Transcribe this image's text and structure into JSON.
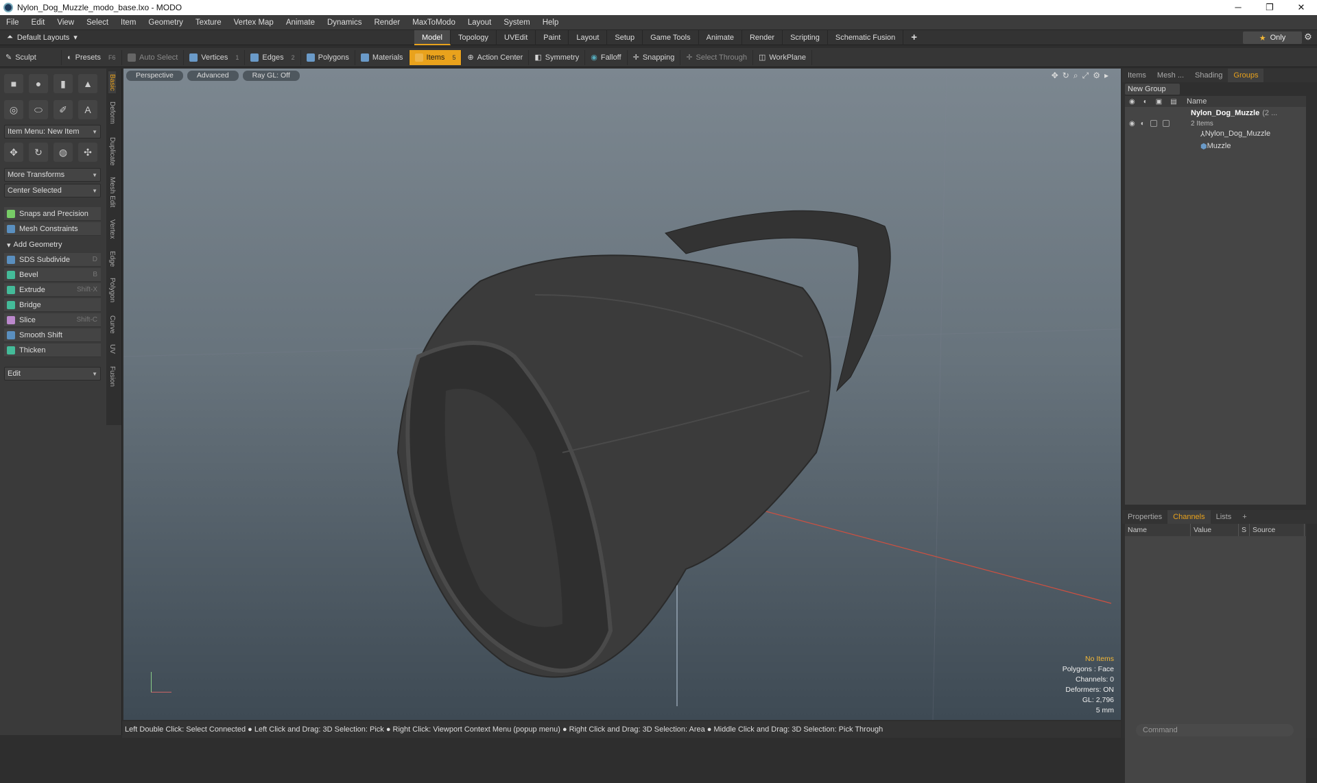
{
  "window": {
    "title": "Nylon_Dog_Muzzle_modo_base.lxo - MODO",
    "min": "─",
    "max": "❐",
    "close": "✕"
  },
  "menu": [
    "File",
    "Edit",
    "View",
    "Select",
    "Item",
    "Geometry",
    "Texture",
    "Vertex Map",
    "Animate",
    "Dynamics",
    "Render",
    "MaxToModo",
    "Layout",
    "System",
    "Help"
  ],
  "layouts": {
    "label": "Default Layouts",
    "tabs": [
      "Model",
      "Topology",
      "UVEdit",
      "Paint",
      "Layout",
      "Setup",
      "Game Tools",
      "Animate",
      "Render",
      "Scripting",
      "Schematic Fusion"
    ],
    "active": "Model",
    "plus": "+",
    "only": "Only"
  },
  "toolbar": {
    "sculpt": "Sculpt",
    "presets": "Presets",
    "presets_key": "F6",
    "auto_select": "Auto Select",
    "vertices": "Vertices",
    "vertices_n": "1",
    "edges": "Edges",
    "edges_n": "2",
    "polygons": "Polygons",
    "materials": "Materials",
    "items": "Items",
    "items_n": "5",
    "action_center": "Action Center",
    "symmetry": "Symmetry",
    "falloff": "Falloff",
    "snapping": "Snapping",
    "select_through": "Select Through",
    "workplane": "WorkPlane"
  },
  "left": {
    "item_menu": "Item Menu: New Item",
    "more_transforms": "More Transforms",
    "center_selected": "Center Selected",
    "snaps": "Snaps and Precision",
    "mesh_constraints": "Mesh Constraints",
    "add_geometry": "Add Geometry",
    "tools": [
      {
        "label": "SDS Subdivide",
        "key": "D"
      },
      {
        "label": "Bevel",
        "key": "B"
      },
      {
        "label": "Extrude",
        "key": "Shift-X"
      },
      {
        "label": "Bridge",
        "key": ""
      },
      {
        "label": "Slice",
        "key": "Shift-C"
      },
      {
        "label": "Smooth Shift",
        "key": ""
      },
      {
        "label": "Thicken",
        "key": ""
      }
    ],
    "edit": "Edit",
    "vtabs": [
      "Basic",
      "Deform",
      "Duplicate",
      "Mesh Edit",
      "Vertex",
      "Edge",
      "Polygon",
      "Curve",
      "UV",
      "Fusion"
    ]
  },
  "viewport": {
    "perspective": "Perspective",
    "advanced": "Advanced",
    "raygl": "Ray GL: Off",
    "info": {
      "no_items": "No Items",
      "polygons": "Polygons : Face",
      "channels": "Channels: 0",
      "deformers": "Deformers: ON",
      "gl": "GL: 2,796",
      "scale": "5 mm"
    }
  },
  "status": "Left Double Click: Select Connected ● Left Click and Drag: 3D Selection: Pick ● Right Click: Viewport Context Menu (popup menu) ● Right Click and Drag: 3D Selection: Area ● Middle Click and Drag: 3D Selection: Pick Through",
  "right": {
    "tabs": [
      "Items",
      "Mesh ...",
      "Shading",
      "Groups"
    ],
    "active_tab": "Groups",
    "new_group": "New Group",
    "name_col": "Name",
    "group_name": "Nylon_Dog_Muzzle",
    "group_count": "(2 ...",
    "group_sub": "2 Items",
    "children": [
      "Nylon_Dog_Muzzle",
      "Muzzle"
    ],
    "bottom_tabs": [
      "Properties",
      "Channels",
      "Lists",
      "+"
    ],
    "bottom_active": "Channels",
    "ch_cols": [
      "Name",
      "Value",
      "S",
      "Source"
    ],
    "command": "Command"
  },
  "colors": {
    "accent": "#e9a21c",
    "viewport_top": "#7c8790",
    "viewport_bottom": "#3e4a54"
  }
}
